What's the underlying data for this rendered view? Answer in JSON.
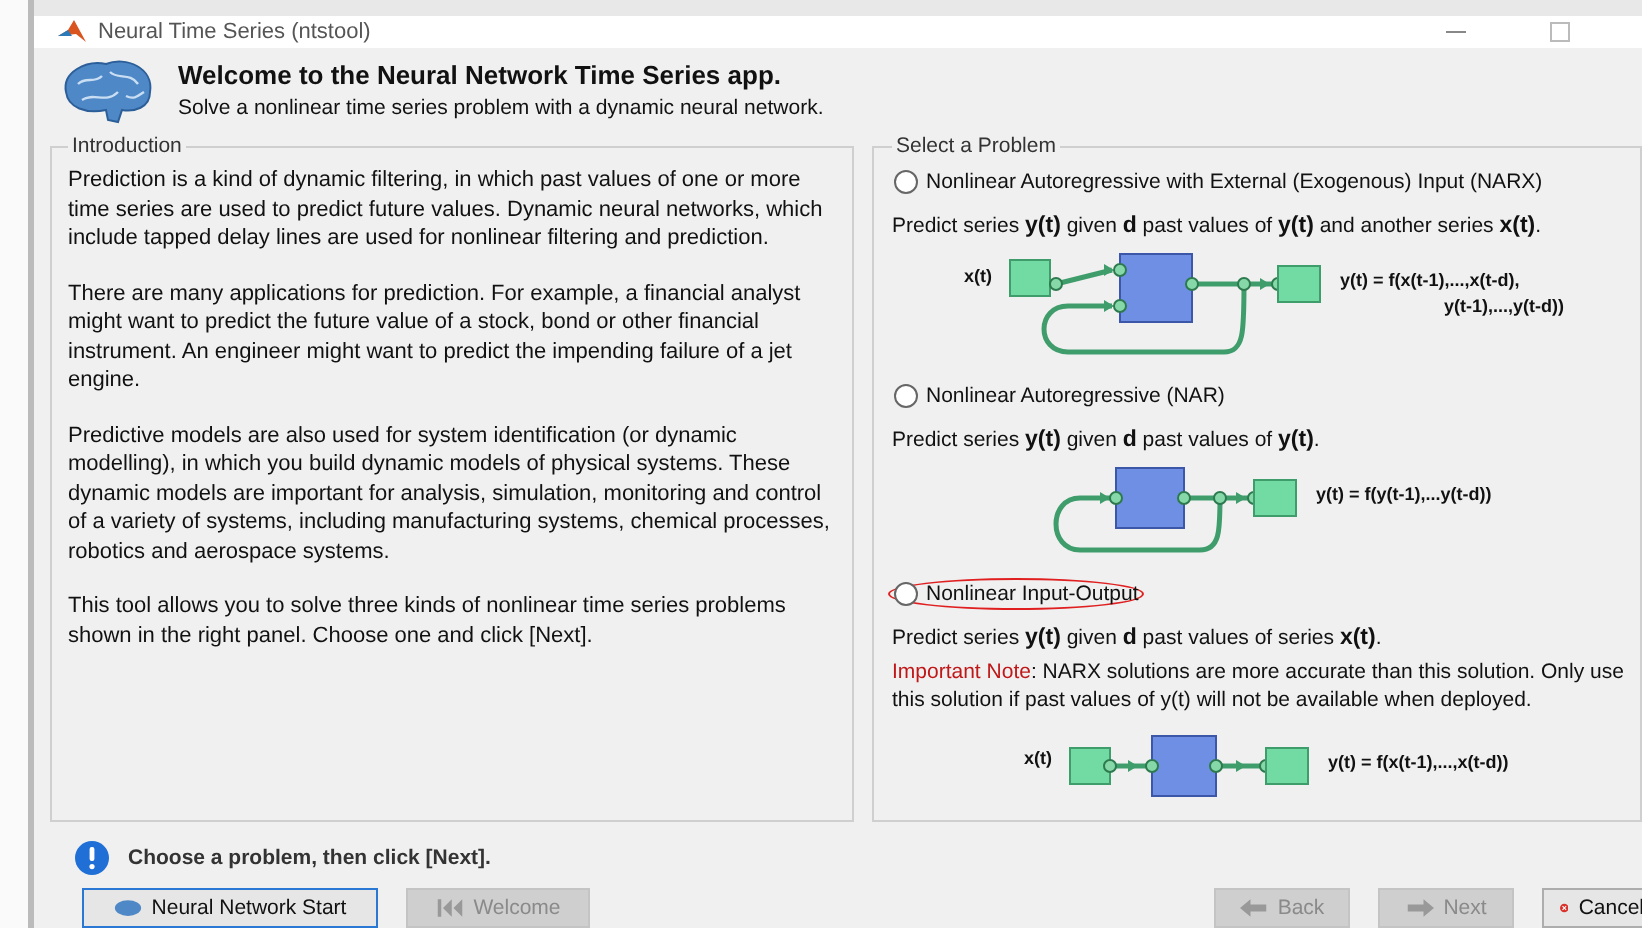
{
  "window": {
    "title": "Neural Time Series (ntstool)"
  },
  "header": {
    "title": "Welcome to the Neural Network Time Series app.",
    "subtitle": "Solve a nonlinear time series problem with a dynamic neural network."
  },
  "introduction": {
    "title": "Introduction",
    "paragraphs": [
      "Prediction is a kind of dynamic filtering, in which past values of one or more time series are used to predict future values. Dynamic neural networks, which include tapped delay lines are used for nonlinear filtering and prediction.",
      "There are many applications for prediction. For example, a financial analyst might want to predict the future value of a stock, bond or other financial instrument. An engineer might want to predict the impending failure of a jet engine.",
      "Predictive models are also used for system identification (or dynamic modelling), in which you build dynamic models of physical systems. These dynamic models are important for analysis, simulation, monitoring and control of a variety of systems, including manufacturing systems, chemical processes, robotics and aerospace systems.",
      "This tool allows you to solve three kinds of nonlinear time series problems shown in the right panel. Choose one and click [Next]."
    ]
  },
  "problems": {
    "title": "Select a Problem",
    "options": [
      {
        "label": "Nonlinear Autoregressive with External (Exogenous) Input (NARX)",
        "selected": false,
        "highlighted": false,
        "description": "Predict series **y(t)** given **d** past values of **y(t)** and another series **x(t)**.",
        "kind": "narx",
        "input": "x(t)",
        "formula": [
          "y(t) = f(x(t-1),...,x(t-d),",
          "y(t-1),...,y(t-d))"
        ]
      },
      {
        "label": "Nonlinear Autoregressive (NAR)",
        "selected": false,
        "highlighted": false,
        "description": "Predict series **y(t)** given **d** past values of **y(t)**.",
        "kind": "nar",
        "formula": [
          "y(t) = f(y(t-1),...y(t-d))"
        ]
      },
      {
        "label": "Nonlinear Input-Output",
        "selected": false,
        "highlighted": true,
        "description": "Predict series **y(t)** given **d** past values of series **x(t)**.",
        "note_label": "Important Note",
        "note_text": ": NARX solutions are more accurate than this solution. Only use this solution if past values of y(t) will not be available when deployed.",
        "kind": "io",
        "input": "x(t)",
        "formula": [
          "y(t) = f(x(t-1),...,x(t-d))"
        ]
      }
    ]
  },
  "status": {
    "message": "Choose a problem, then click [Next]."
  },
  "buttons": [
    {
      "label": "Neural Network Start",
      "kind": "start",
      "disabled": false
    },
    {
      "label": "Welcome",
      "kind": "welcome",
      "disabled": true
    },
    {
      "label": "Back",
      "kind": "back",
      "disabled": true
    },
    {
      "label": "Next",
      "kind": "next",
      "disabled": true
    },
    {
      "label": "Cancel",
      "kind": "cancel",
      "disabled": false
    }
  ]
}
